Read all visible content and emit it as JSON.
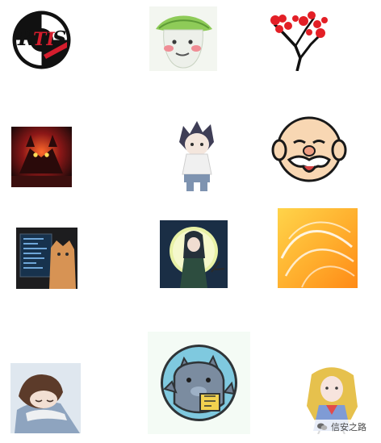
{
  "gallery": {
    "images": [
      {
        "name": "rtis-logo",
        "lettering": "RTIS"
      },
      {
        "name": "green-leaf-hat-cartoon"
      },
      {
        "name": "red-tree-branch-illustration"
      },
      {
        "name": "red-demon-artwork"
      },
      {
        "name": "anime-ninja-chibi"
      },
      {
        "name": "bald-grandpa-cartoon"
      },
      {
        "name": "cat-with-monitor-photo"
      },
      {
        "name": "anime-moon-illustration"
      },
      {
        "name": "orange-swirl-abstract"
      },
      {
        "name": "sleeping-anime-boy"
      },
      {
        "name": "blue-dragon-badge"
      },
      {
        "name": "anime-girl-in-uniform"
      }
    ]
  },
  "watermark": {
    "icon": "wechat-icon",
    "text": "信安之路"
  }
}
